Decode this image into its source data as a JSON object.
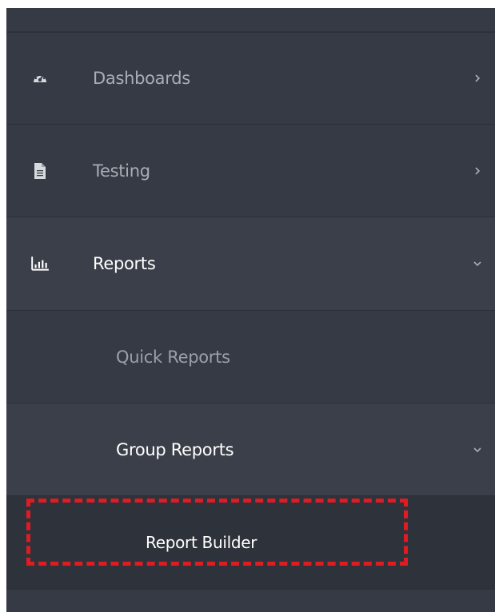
{
  "nav": {
    "items": [
      {
        "label": "Dashboards",
        "icon": "dashboard-gauge-icon",
        "chevron": "chevron-right-icon"
      },
      {
        "label": "Testing",
        "icon": "document-icon",
        "chevron": "chevron-right-icon"
      },
      {
        "label": "Reports",
        "icon": "bar-chart-icon",
        "chevron": "chevron-down-icon",
        "expanded": true
      }
    ],
    "reports_children": [
      {
        "label": "Quick Reports"
      },
      {
        "label": "Group Reports",
        "chevron": "chevron-down-icon",
        "expanded": true
      }
    ],
    "group_reports_children": [
      {
        "label": "Report Builder",
        "highlighted": true
      }
    ]
  },
  "colors": {
    "sidebar_bg": "#353a44",
    "active_row_bg": "#3a3f49",
    "highlight_border": "#e11b22"
  }
}
